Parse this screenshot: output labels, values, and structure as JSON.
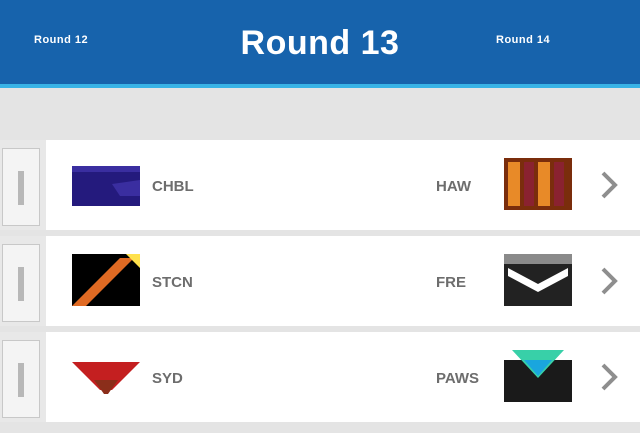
{
  "header": {
    "left_link": "Round 12",
    "title": "Round 13",
    "right_link": "Round 14"
  },
  "subheader": {
    "text": ""
  },
  "matches": [
    {
      "home": {
        "abbr": "CHBL",
        "logo_colors": [
          "#241a7d",
          "#3a2ea0"
        ]
      },
      "away": {
        "abbr": "HAW",
        "logo_colors": [
          "#7a2d0c",
          "#e88a28",
          "#8a2230"
        ]
      },
      "status_line1": "",
      "status_line2": ""
    },
    {
      "home": {
        "abbr": "STCN",
        "logo_colors": [
          "#000000",
          "#e06a23",
          "#ffe14c"
        ]
      },
      "away": {
        "abbr": "FRE",
        "logo_colors": [
          "#222222",
          "#ffffff",
          "#8a8a8a"
        ]
      },
      "status_line1": "",
      "status_line2": ""
    },
    {
      "home": {
        "abbr": "SYD",
        "logo_colors": [
          "#c41f20",
          "#ffffff",
          "#8b2e1a"
        ]
      },
      "away": {
        "abbr": "PAWS",
        "logo_colors": [
          "#1a1a1a",
          "#1aa6de",
          "#38d0a8"
        ]
      },
      "status_line1": "",
      "status_line2": ""
    }
  ],
  "colors": {
    "header_bg": "#1763ac",
    "header_accent": "#38b3e6",
    "page_bg": "#e4e4e4",
    "card_bg": "#ffffff"
  },
  "icons": {
    "chevron": "chevron-right-icon"
  }
}
